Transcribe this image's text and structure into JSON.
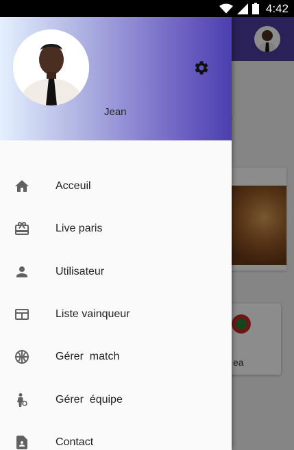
{
  "status_bar": {
    "time": "4:42",
    "icons": [
      "wifi-icon",
      "signal-icon",
      "battery-icon"
    ]
  },
  "drawer": {
    "header": {
      "user_name": "Jean",
      "settings_icon": "gear-icon"
    },
    "items": [
      {
        "label": "Acceuil",
        "icon": "home-icon"
      },
      {
        "label": "Live paris",
        "icon": "gift-card-icon"
      },
      {
        "label": "Utilisateur",
        "icon": "person-icon"
      },
      {
        "label": "Liste vainqueur",
        "icon": "list-panel-icon"
      },
      {
        "label": "Gérer  match",
        "icon": "basketball-icon"
      },
      {
        "label": "Gérer  équipe",
        "icon": "player-icon"
      },
      {
        "label": "Contact",
        "icon": "contact-file-icon"
      }
    ]
  },
  "background": {
    "card_fragment_text": "ea",
    "stray_text": "e"
  },
  "colors": {
    "appbar": "#4b3d9f",
    "header_start": "#e4f0fd",
    "header_end": "#4b3fae",
    "icon": "#616161"
  }
}
